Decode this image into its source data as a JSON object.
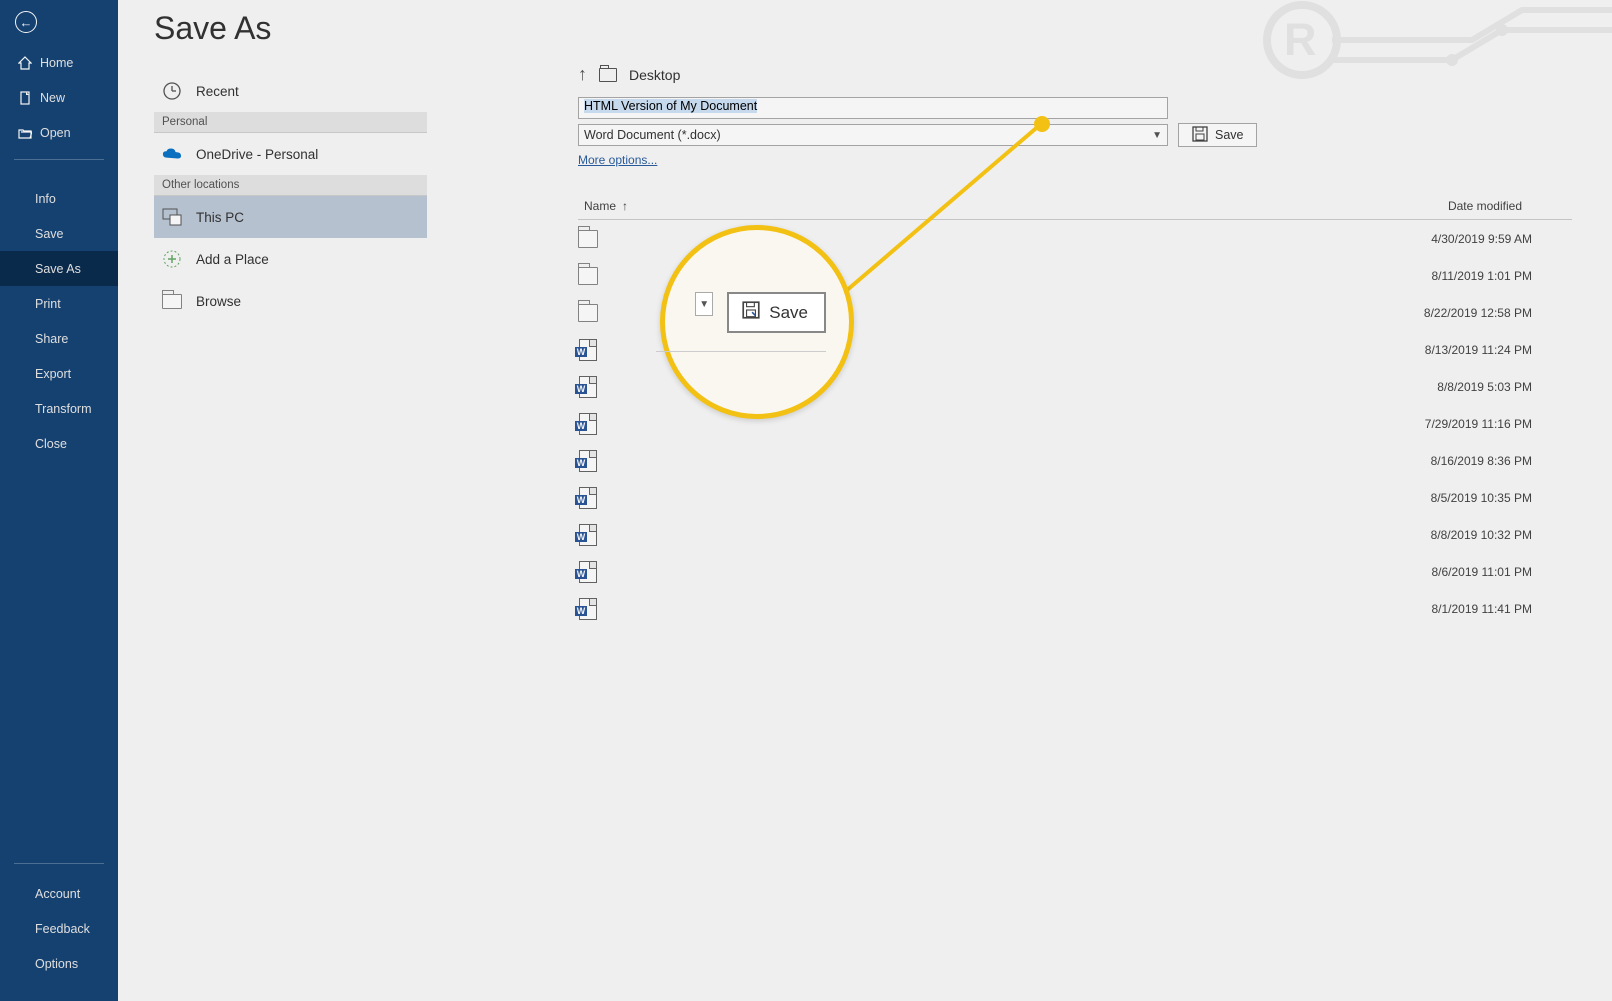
{
  "page": {
    "title": "Save As"
  },
  "sidebar": {
    "items_top": [
      {
        "label": "Home",
        "icon": "home"
      },
      {
        "label": "New",
        "icon": "new"
      },
      {
        "label": "Open",
        "icon": "open"
      }
    ],
    "items_mid": [
      {
        "label": "Info"
      },
      {
        "label": "Save"
      },
      {
        "label": "Save As",
        "active": true
      },
      {
        "label": "Print"
      },
      {
        "label": "Share"
      },
      {
        "label": "Export"
      },
      {
        "label": "Transform"
      },
      {
        "label": "Close"
      }
    ],
    "items_bottom": [
      {
        "label": "Account"
      },
      {
        "label": "Feedback"
      },
      {
        "label": "Options"
      }
    ]
  },
  "locations": {
    "recent": "Recent",
    "personal_header": "Personal",
    "onedrive": "OneDrive - Personal",
    "other_header": "Other locations",
    "this_pc": "This PC",
    "add_place": "Add a Place",
    "browse": "Browse"
  },
  "breadcrumb": {
    "folder": "Desktop"
  },
  "filename": "HTML Version of My Document",
  "filetype": "Word Document (*.docx)",
  "more_options": "More options...",
  "save_label": "Save",
  "columns": {
    "name": "Name",
    "date": "Date modified"
  },
  "files": [
    {
      "type": "folder",
      "date": "4/30/2019 9:59 AM"
    },
    {
      "type": "folder",
      "date": "8/11/2019 1:01 PM"
    },
    {
      "type": "folder",
      "date": "8/22/2019 12:58 PM"
    },
    {
      "type": "doc",
      "date": "8/13/2019 11:24 PM"
    },
    {
      "type": "doc",
      "date": "8/8/2019 5:03 PM"
    },
    {
      "type": "doc",
      "date": "7/29/2019 11:16 PM"
    },
    {
      "type": "doc",
      "date": "8/16/2019 8:36 PM"
    },
    {
      "type": "doc",
      "date": "8/5/2019 10:35 PM"
    },
    {
      "type": "doc",
      "date": "8/8/2019 10:32 PM"
    },
    {
      "type": "doc",
      "date": "8/6/2019 11:01 PM"
    },
    {
      "type": "doc",
      "date": "8/1/2019 11:41 PM"
    }
  ],
  "callout": {
    "save": "Save"
  }
}
